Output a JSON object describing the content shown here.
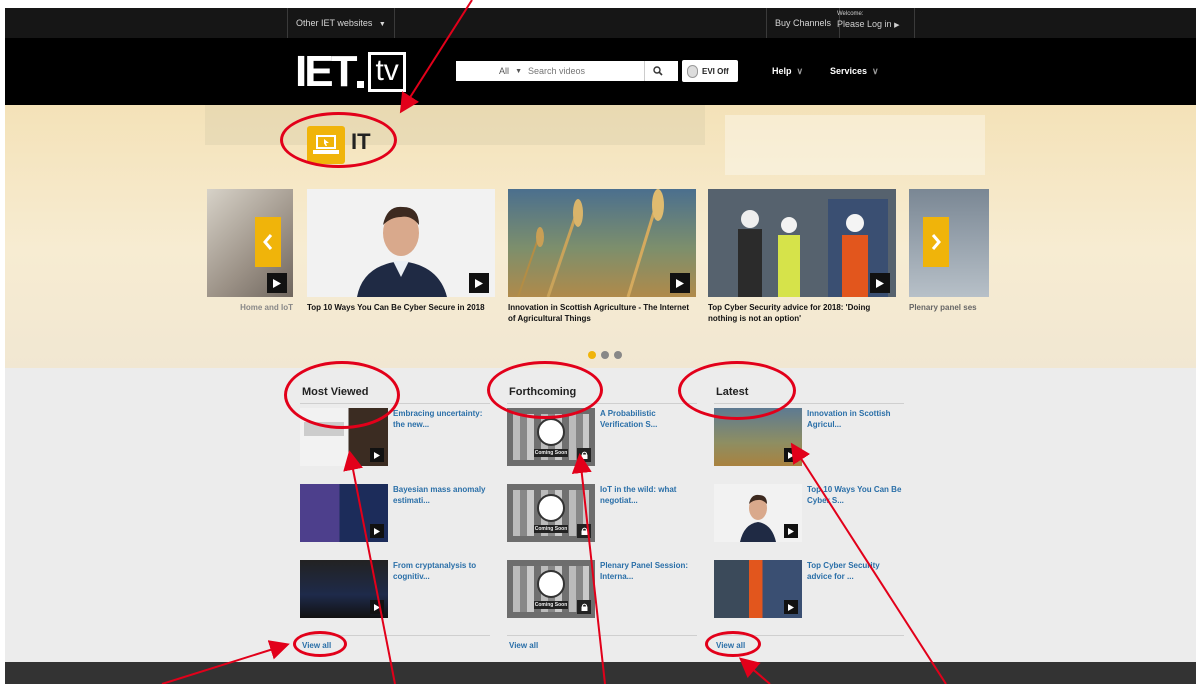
{
  "utility_bar": {
    "other_sites": "Other IET websites",
    "buy_channels": "Buy Channels",
    "welcome": "Welcome:",
    "login": "Please Log in"
  },
  "header": {
    "logo_iet": "IET",
    "logo_tv": "tv",
    "search_scope": "All",
    "search_placeholder": "Search videos",
    "evi_label": "EVI Off",
    "nav": [
      {
        "label": "Help"
      },
      {
        "label": "Services"
      }
    ]
  },
  "hero": {
    "topic_title": "IT",
    "active_dot": 0,
    "dot_count": 3,
    "cards": [
      {
        "title": "Home and IoT"
      },
      {
        "title": "Top 10 Ways You Can Be Cyber Secure in 2018"
      },
      {
        "title": "Innovation in Scottish Agriculture - The Internet of Agricultural Things"
      },
      {
        "title": "Top Cyber Security advice for 2018: 'Doing nothing is not an option'"
      },
      {
        "title": "Plenary panel ses"
      }
    ]
  },
  "sections": [
    {
      "heading": "Most Viewed",
      "items": [
        {
          "title": "Embracing uncertainty: the new..."
        },
        {
          "title": "Bayesian mass anomaly estimati..."
        },
        {
          "title": "From cryptanalysis to cognitiv..."
        }
      ],
      "view_all": "View all"
    },
    {
      "heading": "Forthcoming",
      "items": [
        {
          "title": "A Probabilistic Verification S...",
          "badge": "Coming Soon"
        },
        {
          "title": "IoT in the wild: what negotiat...",
          "badge": "Coming Soon"
        },
        {
          "title": "Plenary Panel Session: Interna...",
          "badge": "Coming Soon"
        }
      ],
      "view_all": "View all"
    },
    {
      "heading": "Latest",
      "items": [
        {
          "title": "Innovation in Scottish Agricul..."
        },
        {
          "title": "Top 10 Ways You Can Be Cyber S..."
        },
        {
          "title": "Top Cyber Security advice for ..."
        }
      ],
      "view_all": "View all"
    }
  ],
  "colors": {
    "accent": "#f0b40a",
    "link": "#2a6fa8",
    "annotation": "#e2001a"
  }
}
